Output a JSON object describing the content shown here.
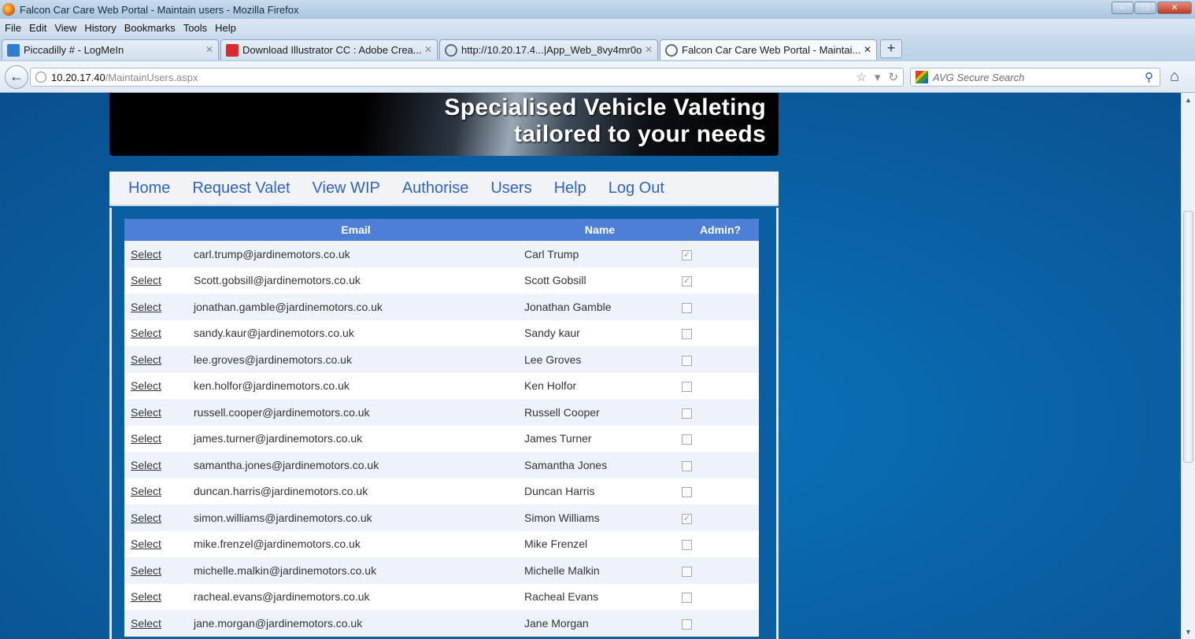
{
  "window": {
    "title": "Falcon Car Care Web Portal - Maintain users - Mozilla Firefox"
  },
  "menu": [
    "File",
    "Edit",
    "View",
    "History",
    "Bookmarks",
    "Tools",
    "Help"
  ],
  "tabs": [
    {
      "label": "Piccadilly # - LogMeIn",
      "icon_color": "#2f7fd0"
    },
    {
      "label": "Download Illustrator CC : Adobe Crea...",
      "icon_color": "#d92b2b"
    },
    {
      "label": "http://10.20.17.4...|App_Web_8vy4mr0o",
      "icon_color": "#5a6b82"
    },
    {
      "label": "Falcon Car Care Web Portal - Maintai...",
      "icon_color": "#5a6b82"
    }
  ],
  "address": {
    "host": "10.20.17.40",
    "path": "/MaintainUsers.aspx"
  },
  "search": {
    "placeholder": "AVG Secure Search"
  },
  "banner": {
    "line1": "Specialised Vehicle Valeting",
    "line2": "tailored to your needs"
  },
  "nav": [
    "Home",
    "Request Valet",
    "View WIP",
    "Authorise",
    "Users",
    "Help",
    "Log Out"
  ],
  "grid": {
    "headers": {
      "email": "Email",
      "name": "Name",
      "admin": "Admin?"
    },
    "select_label": "Select",
    "rows": [
      {
        "email": "carl.trump@jardinemotors.co.uk",
        "name": "Carl Trump",
        "admin": true
      },
      {
        "email": "Scott.gobsill@jardinemotors.co.uk",
        "name": "Scott Gobsill",
        "admin": true
      },
      {
        "email": "jonathan.gamble@jardinemotors.co.uk",
        "name": "Jonathan Gamble",
        "admin": false
      },
      {
        "email": "sandy.kaur@jardinemotors.co.uk",
        "name": "Sandy kaur",
        "admin": false
      },
      {
        "email": "lee.groves@jardinemotors.co.uk",
        "name": "Lee Groves",
        "admin": false
      },
      {
        "email": "ken.holfor@jardinemotors.co.uk",
        "name": "Ken Holfor",
        "admin": false
      },
      {
        "email": "russell.cooper@jardinemotors.co.uk",
        "name": "Russell Cooper",
        "admin": false
      },
      {
        "email": "james.turner@jardinemotors.co.uk",
        "name": "James Turner",
        "admin": false
      },
      {
        "email": "samantha.jones@jardinemotors.co.uk",
        "name": "Samantha Jones",
        "admin": false
      },
      {
        "email": "duncan.harris@jardinemotors.co.uk",
        "name": "Duncan Harris",
        "admin": false
      },
      {
        "email": "simon.williams@jardinemotors.co.uk",
        "name": "Simon Williams",
        "admin": true
      },
      {
        "email": "mike.frenzel@jardinemotors.co.uk",
        "name": "Mike Frenzel",
        "admin": false
      },
      {
        "email": "michelle.malkin@jardinemotors.co.uk",
        "name": "Michelle Malkin",
        "admin": false
      },
      {
        "email": "racheal.evans@jardinemotors.co.uk",
        "name": "Racheal Evans",
        "admin": false
      },
      {
        "email": "jane.morgan@jardinemotors.co.uk",
        "name": "Jane Morgan",
        "admin": false
      }
    ]
  }
}
